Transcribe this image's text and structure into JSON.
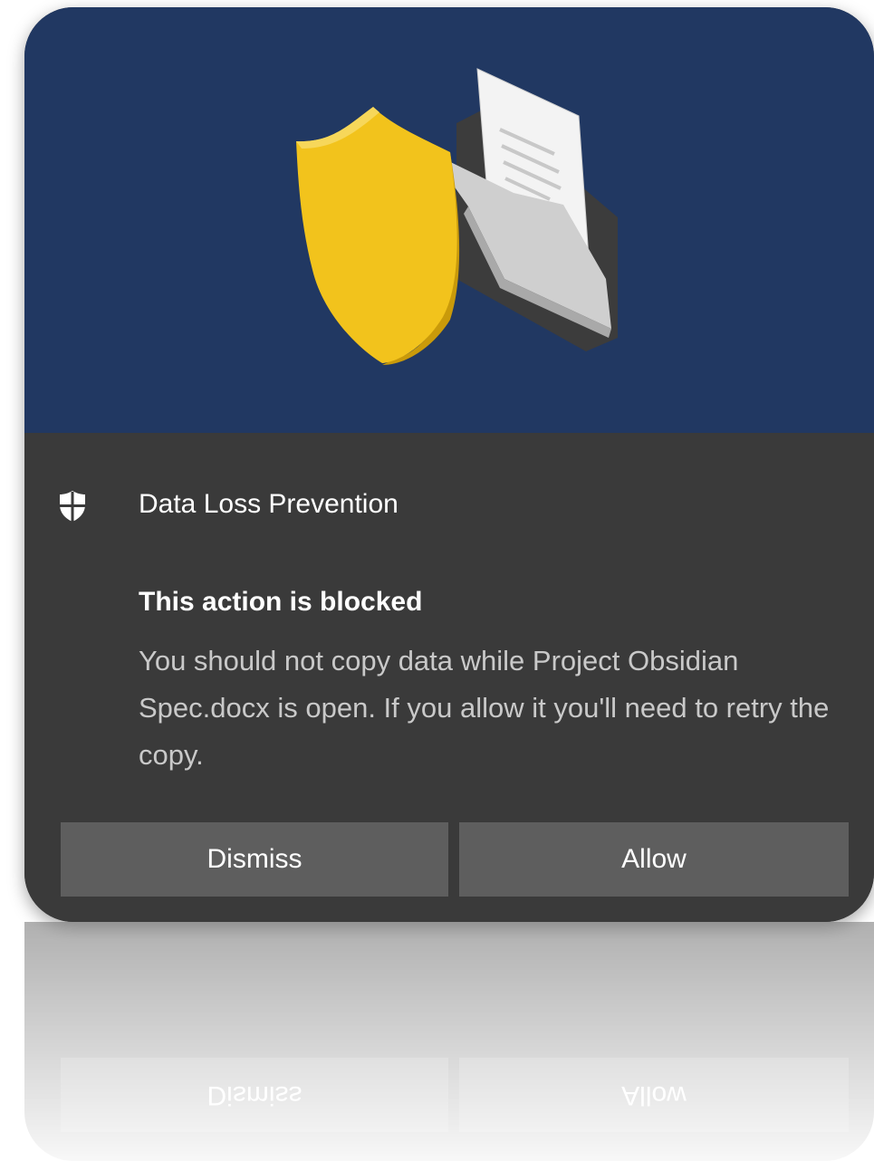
{
  "notification": {
    "app_name": "Data Loss Prevention",
    "icon": "shield-icon",
    "headline": "This action is blocked",
    "body": "You should not copy data while Project Obsidian Spec.docx is open. If you allow it you'll need to retry the copy.",
    "body_reflection_visible": "you'll need to retry the copy.",
    "buttons": {
      "dismiss_label": "Dismiss",
      "allow_label": "Allow"
    },
    "hero_illustration": "shield-and-folder-illustration"
  },
  "colors": {
    "hero_background": "#213862",
    "card_background": "#3a3a3a",
    "button_background": "#5e5e5e",
    "shield_yellow": "#f2c31c",
    "body_text": "#c9c9c9"
  }
}
